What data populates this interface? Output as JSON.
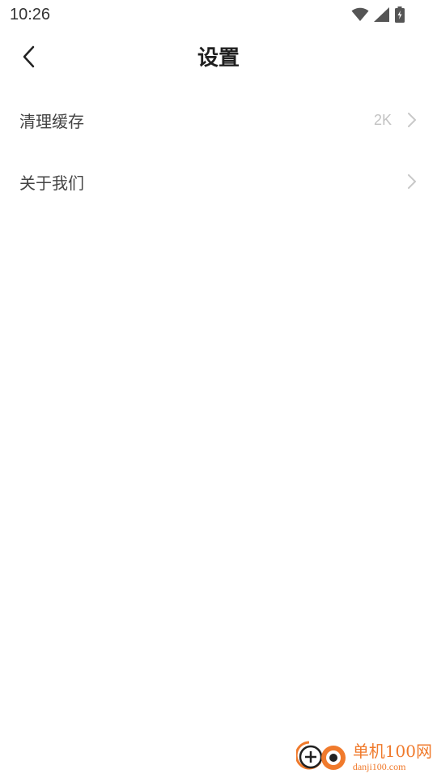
{
  "status_bar": {
    "time": "10:26",
    "icons": [
      "wifi-icon",
      "cellular-signal-icon",
      "battery-charging-icon"
    ]
  },
  "header": {
    "back_icon": "chevron-left-icon",
    "title": "设置"
  },
  "settings": {
    "items": [
      {
        "label": "清理缓存",
        "value": "2K",
        "icon": "chevron-right-icon"
      },
      {
        "label": "关于我们",
        "value": "",
        "icon": "chevron-right-icon"
      }
    ]
  },
  "watermark": {
    "title": "单机100网",
    "subtitle": "danji100.com",
    "accent_color": "#f07a2c"
  },
  "colors": {
    "background": "#ffffff",
    "title": "#1f1f1f",
    "label": "#444444",
    "value": "#c2c2c2",
    "chevron": "#c8c8c8"
  }
}
